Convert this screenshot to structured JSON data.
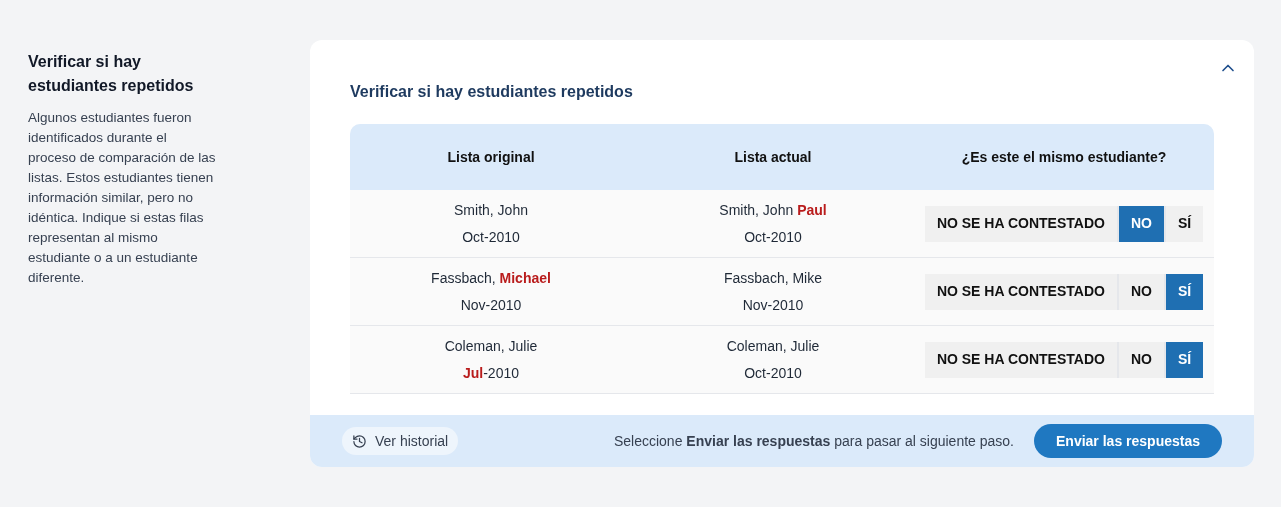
{
  "sidebar": {
    "title": "Verificar si hay estudiantes repetidos",
    "description": "Algunos estudiantes fueron identificados durante el proceso de comparación de las listas. Estos estudiantes tienen información similar, pero no idéntica. Indique si estas filas representan al mismo estudiante o a un estudiante diferente."
  },
  "panel": {
    "title": "Verificar si hay estudiantes repetidos",
    "expanded": true,
    "table": {
      "columns": [
        "Lista original",
        "Lista actual",
        "¿Es este el mismo estudiante?"
      ],
      "rows": [
        {
          "original": [
            [
              {
                "text": "Smith, John",
                "changed": false
              }
            ],
            [
              {
                "text": "Oct-2010",
                "changed": false
              }
            ]
          ],
          "actual": [
            [
              {
                "text": "Smith, John ",
                "changed": false
              },
              {
                "text": "Paul",
                "changed": true
              }
            ],
            [
              {
                "text": "Oct-2010",
                "changed": false
              }
            ]
          ],
          "options": [
            {
              "label": "NO SE HA CONTESTADO",
              "selected": false
            },
            {
              "label": "NO",
              "selected": true
            },
            {
              "label": "SÍ",
              "selected": false
            }
          ]
        },
        {
          "original": [
            [
              {
                "text": "Fassbach, ",
                "changed": false
              },
              {
                "text": "Michael",
                "changed": true
              }
            ],
            [
              {
                "text": "Nov-2010",
                "changed": false
              }
            ]
          ],
          "actual": [
            [
              {
                "text": "Fassbach, Mike",
                "changed": false
              }
            ],
            [
              {
                "text": "Nov-2010",
                "changed": false
              }
            ]
          ],
          "options": [
            {
              "label": "NO SE HA CONTESTADO",
              "selected": false
            },
            {
              "label": "NO",
              "selected": false
            },
            {
              "label": "SÍ",
              "selected": true
            }
          ]
        },
        {
          "original": [
            [
              {
                "text": "Coleman, Julie",
                "changed": false
              }
            ],
            [
              {
                "text": "Jul",
                "changed": true
              },
              {
                "text": "-2010",
                "changed": false
              }
            ]
          ],
          "actual": [
            [
              {
                "text": "Coleman, Julie",
                "changed": false
              }
            ],
            [
              {
                "text": "Oct-2010",
                "changed": false
              }
            ]
          ],
          "options": [
            {
              "label": "NO SE HA CONTESTADO",
              "selected": false
            },
            {
              "label": "NO",
              "selected": false
            },
            {
              "label": "SÍ",
              "selected": true
            }
          ]
        }
      ]
    },
    "footer": {
      "history_button": "Ver historial",
      "hint": "Seleccione **Enviar las respuestas** para pasar al siguiente paso.",
      "submit_button": "Enviar las respuestas"
    }
  }
}
